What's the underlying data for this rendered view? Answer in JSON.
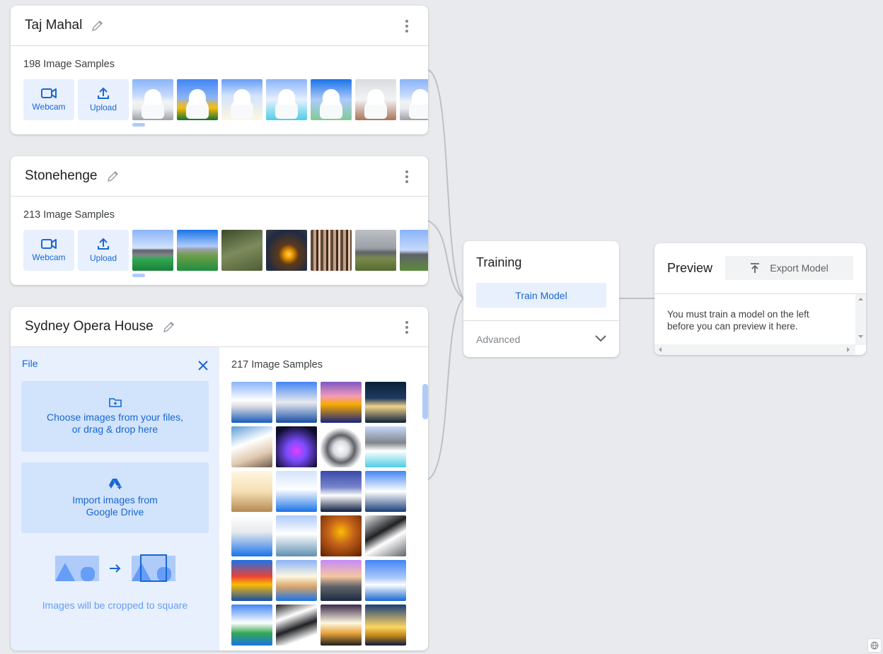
{
  "classes": [
    {
      "name": "Taj Mahal",
      "samples_label": "198 Image Samples",
      "webcam_label": "Webcam",
      "upload_label": "Upload"
    },
    {
      "name": "Stonehenge",
      "samples_label": "213 Image Samples",
      "webcam_label": "Webcam",
      "upload_label": "Upload"
    },
    {
      "name": "Sydney Opera House",
      "samples_label": "217 Image Samples",
      "file_panel": {
        "label": "File",
        "choose_line1": "Choose images from your files,",
        "choose_line2": "or drag & drop here",
        "drive_line1": "Import images from",
        "drive_line2": "Google Drive",
        "crop_note": "Images will be cropped to square"
      }
    }
  ],
  "training": {
    "title": "Training",
    "train_button": "Train Model",
    "advanced_label": "Advanced"
  },
  "preview": {
    "title": "Preview",
    "export_button": "Export Model",
    "message_line1": "You must train a model on the left",
    "message_line2": "before you can preview it here."
  },
  "colors": {
    "accent": "#1967d2",
    "accent_light": "#e8f0fe",
    "background": "#e8eaed",
    "connector": "#bdc1c6"
  },
  "icons": [
    "pencil-icon",
    "more-vert-icon",
    "webcam-icon",
    "upload-icon",
    "close-icon",
    "folder-add-icon",
    "drive-add-icon",
    "arrow-right-icon",
    "chevron-down-icon",
    "export-icon",
    "globe-icon"
  ]
}
